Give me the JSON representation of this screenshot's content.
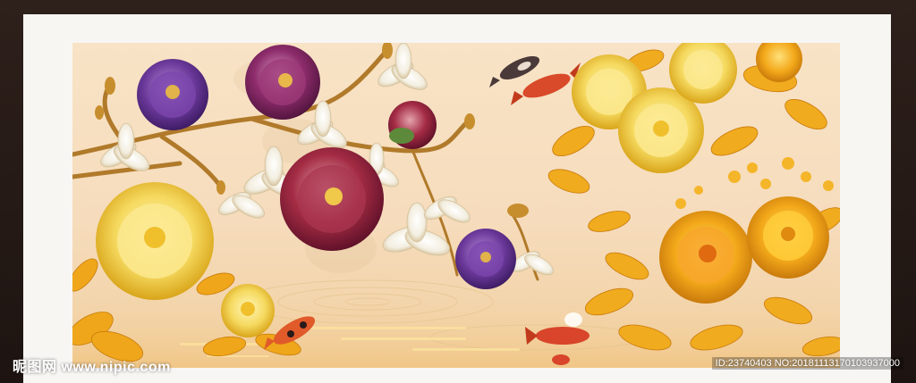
{
  "watermark": {
    "site": "昵图网 www.nipic.com",
    "id_text": "ID:23740403 NO:20181113170103937000"
  },
  "artwork": {
    "subject": "peonies-magnolias-koi-painting",
    "colors": {
      "background": "#f8e3c6",
      "gold": "#f2b21c",
      "purple": "#6b3a9a",
      "crimson": "#9c2a3a",
      "cream": "#f6eaa8",
      "koi_red": "#d8452a"
    }
  }
}
